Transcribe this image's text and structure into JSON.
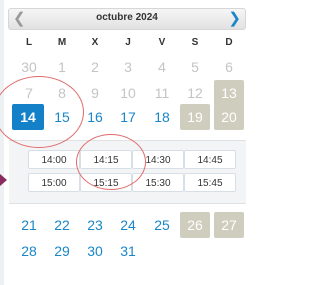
{
  "calendar": {
    "month_title": "octubre 2024",
    "prev_icon": "chevron-left-icon",
    "next_icon": "chevron-right-icon",
    "weekdays": [
      "L",
      "M",
      "X",
      "J",
      "V",
      "S",
      "D"
    ],
    "weeks": [
      [
        "30",
        "1",
        "2",
        "3",
        "4",
        "5",
        "6"
      ],
      [
        "7",
        "8",
        "9",
        "10",
        "11",
        "12",
        "13"
      ],
      [
        "14",
        "15",
        "16",
        "17",
        "18",
        "19",
        "20"
      ],
      [
        "21",
        "22",
        "23",
        "24",
        "25",
        "26",
        "27"
      ],
      [
        "28",
        "29",
        "30",
        "31"
      ]
    ],
    "selected_day": "14"
  },
  "time_slots": {
    "row1": [
      "14:00",
      "14:15",
      "14:30",
      "14:45"
    ],
    "row2": [
      "15:00",
      "15:15",
      "15:30",
      "15:45"
    ]
  },
  "colors": {
    "accent": "#1380c7",
    "link_blue": "#1a86c8",
    "weekend_bg": "#cfcdbd",
    "annotation_red": "#e06a6a"
  }
}
